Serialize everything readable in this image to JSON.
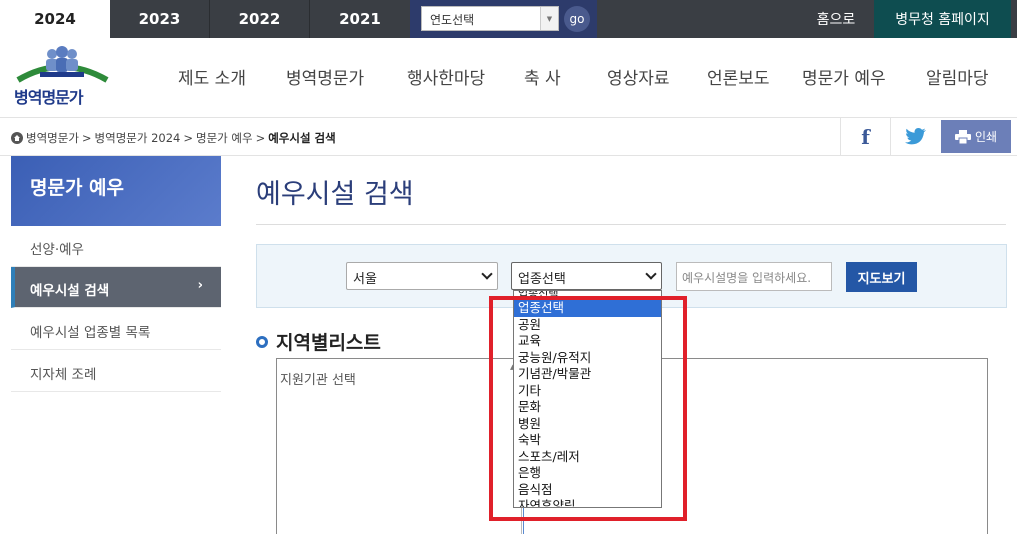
{
  "top_bar": {
    "years": [
      "2024",
      "2023",
      "2022",
      "2021"
    ],
    "active_year": "2024",
    "year_select_value": "연도선택",
    "go_label": "go",
    "home_label": "홈으로",
    "mma_label": "병무청 홈페이지"
  },
  "logo": {
    "text": "병역명문가"
  },
  "nav": {
    "items": [
      "제도 소개",
      "병역명문가",
      "행사한마당",
      "축 사",
      "영상자료",
      "언론보도",
      "명문가 예우",
      "알림마당"
    ]
  },
  "breadcrumb": {
    "items": [
      "병역명문가",
      "병역명문가 2024",
      "명문가 예우"
    ],
    "current": "예우시설 검색",
    "print_label": "인쇄"
  },
  "sidebar": {
    "title": "명문가 예우",
    "items": [
      "선양·예우",
      "예우시설 검색",
      "예우시설 업종별 목록",
      "지자체 조례"
    ],
    "active_index": 1
  },
  "main": {
    "title": "예우시설 검색",
    "region_select": "서울",
    "category_select": "업종선택",
    "facility_placeholder": "예우시설명을 입력하세요.",
    "map_button": "지도보기",
    "list_title": "지역별리스트",
    "list_label": "지원기관 선택"
  },
  "dropdown": {
    "options": [
      "업종선택",
      "공원",
      "교육",
      "궁능원/유적지",
      "기념관/박물관",
      "기타",
      "문화",
      "병원",
      "숙박",
      "스포츠/레저",
      "은행",
      "음식점",
      "자연휴양림"
    ],
    "highlighted": "업종선택"
  },
  "colors": {
    "top_bar": "#3a3e44",
    "sidebar_head": "#4a68b8",
    "accent_blue": "#2457a6",
    "highlight_red": "#e0202a"
  }
}
